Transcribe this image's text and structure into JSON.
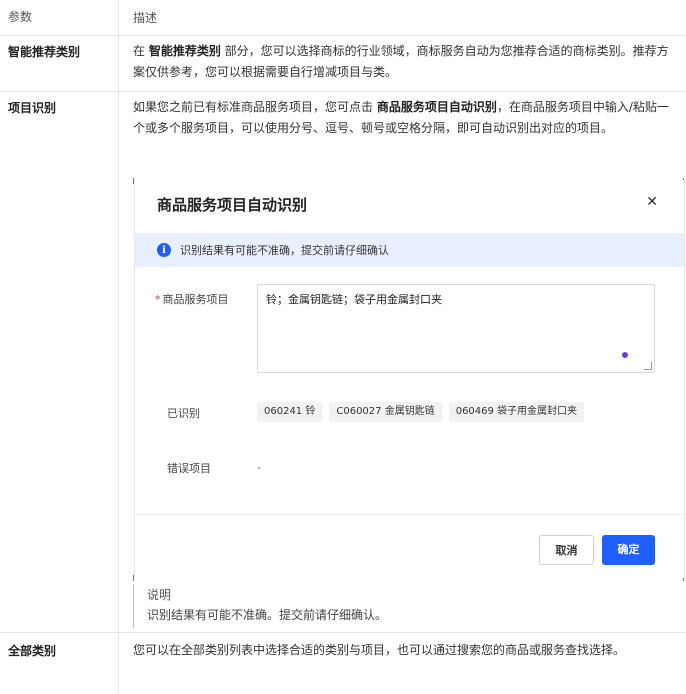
{
  "table": {
    "header": {
      "param": "参数",
      "desc": "描述"
    },
    "rows": [
      {
        "param": "智能推荐类别",
        "desc_prefix": "在 ",
        "desc_bold": "智能推荐类别",
        "desc_suffix": " 部分，您可以选择商标的行业领域，商标服务自动为您推荐合适的商标类别。推荐方案仅供参考，您可以根据需要自行增减项目与类。"
      },
      {
        "param": "项目识别",
        "desc_prefix": "如果您之前已有标准商品服务项目，您可点击 ",
        "desc_bold": "商品服务项目自动识别",
        "desc_suffix": "，在商品服务项目中输入/粘贴一个或多个服务项目，可以使用分号、逗号、顿号或空格分隔，即可自动识别出对应的项目。"
      },
      {
        "param": "全部类别",
        "desc": "您可以在全部类别列表中选择合适的类别与项目，也可以通过搜索您的商品或服务查找选择。"
      }
    ]
  },
  "dialog": {
    "title": "商品服务项目自动识别",
    "close_icon": "close-icon",
    "alert_icon": "info-icon",
    "alert_text": "识别结果有可能不准确，提交前请仔细确认",
    "field_label": "商品服务项目",
    "required_mark": "*",
    "field_value": "铃；金属钥匙链；袋子用金属封口夹",
    "recognized_label": "已识别",
    "recognized_tags": [
      "060241 铃",
      "C060027 金属钥匙链",
      "060469 袋子用金属封口夹"
    ],
    "error_label": "错误项目",
    "error_value": "-",
    "cancel_label": "取消",
    "ok_label": "确定",
    "colors": {
      "primary": "#1f5eff",
      "alert_bg": "#e8efff",
      "required": "#e53935"
    }
  },
  "note": {
    "title": "说明",
    "body": "识别结果有可能不准确。提交前请仔细确认。"
  }
}
